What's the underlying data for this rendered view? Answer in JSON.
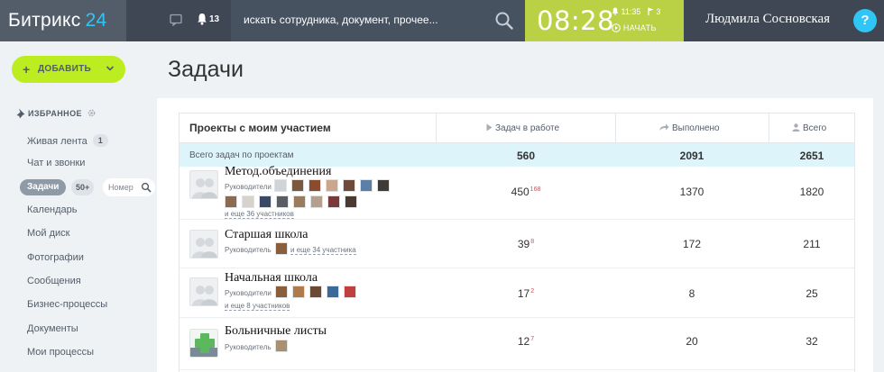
{
  "header": {
    "logo_text": "Битрикс",
    "logo_number": "24",
    "notifications_count": "13",
    "search_placeholder": "искать сотрудника, документ, прочее...",
    "time": "08:28",
    "alarm_time": "11:35",
    "tasks_flag_count": "3",
    "start_label": "НАЧАТЬ",
    "user_name": "Людмила Сосновская",
    "help_label": "?",
    "colors": {
      "bar": "#3e4753",
      "logo_bg": "#535c69",
      "accent": "#2fc6f6",
      "timeman": "#bbd145"
    }
  },
  "sidebar": {
    "add_button": "ДОБАВИТЬ",
    "favorites_label": "ИЗБРАННОЕ",
    "items": [
      {
        "label": "Живая лента",
        "badge": "1"
      },
      {
        "label": "Чат и звонки"
      },
      {
        "label": "Задачи",
        "badge": "50+",
        "active": true
      },
      {
        "label": "Календарь"
      },
      {
        "label": "Мой диск"
      },
      {
        "label": "Фотографии"
      },
      {
        "label": "Сообщения"
      },
      {
        "label": "Бизнес-процессы"
      },
      {
        "label": "Документы"
      },
      {
        "label": "Мои процессы"
      }
    ],
    "search_placeholder": "Номер",
    "colors": {
      "add_button": "#bbed21",
      "active_item": "#8e9aa6"
    }
  },
  "main": {
    "title": "Задачи",
    "table": {
      "title": "Проекты с моим участием",
      "columns": [
        "Задач в работе",
        "Выполнено",
        "Всего"
      ],
      "summary": {
        "label": "Всего задач по проектам",
        "in_work": "560",
        "done": "2091",
        "total": "2651"
      },
      "rows": [
        {
          "name": "Метод.объединения",
          "role": "Руководители",
          "more": "и еще 36 участников",
          "in_work": "450",
          "counter": "168",
          "done": "1370",
          "total": "1820"
        },
        {
          "name": "Старшая школа",
          "role": "Руководитель",
          "more": "и еще 34 участника",
          "in_work": "39",
          "counter": "8",
          "done": "172",
          "total": "211"
        },
        {
          "name": "Начальная школа",
          "role": "Руководители",
          "more": "и еще 8 участников",
          "in_work": "17",
          "counter": "2",
          "done": "8",
          "total": "25"
        },
        {
          "name": "Больничные листы",
          "role": "Руководитель",
          "in_work": "12",
          "counter": "7",
          "done": "20",
          "total": "32"
        }
      ],
      "colors": {
        "summary_bg": "#def4fb",
        "counter": "#d4525c"
      }
    }
  }
}
